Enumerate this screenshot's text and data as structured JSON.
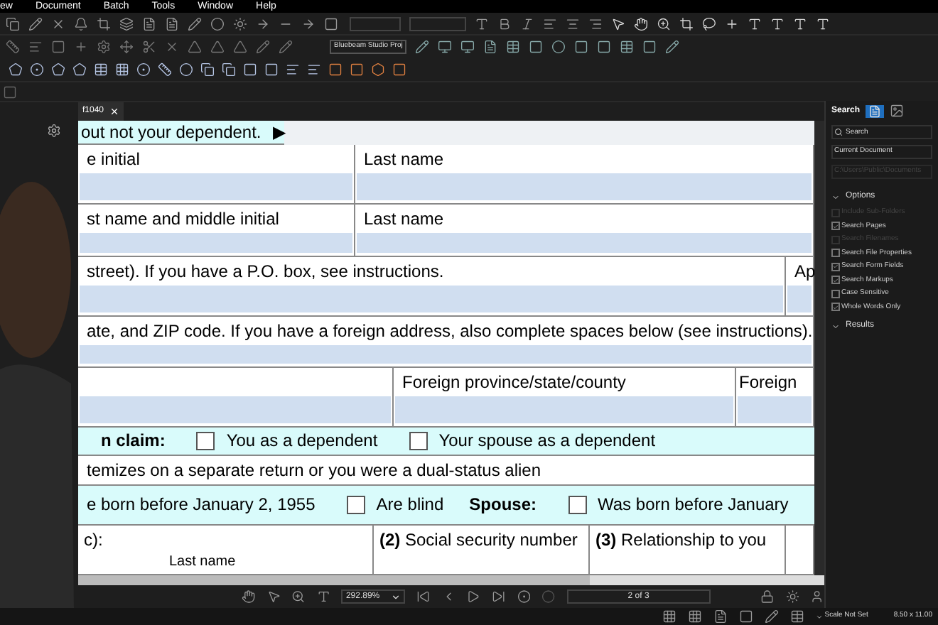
{
  "menu": [
    "ew",
    "Document",
    "Batch",
    "Tools",
    "Window",
    "Help"
  ],
  "toolbar": {
    "studio_project": "Bluebeam Studio Proj"
  },
  "tabs": [
    {
      "label": "f1040",
      "selected": true
    }
  ],
  "form": [
    {
      "kind": "banner",
      "text": "out not your dependent.",
      "arrow": "▶"
    },
    {
      "kind": "fields",
      "cells": [
        {
          "label": "e initial"
        },
        {
          "label": "Last name"
        }
      ]
    },
    {
      "kind": "fields",
      "cells": [
        {
          "label": "st name and middle initial"
        },
        {
          "label": "Last name"
        }
      ]
    },
    {
      "kind": "fields",
      "cells": [
        {
          "label": "street). If you have a P.O. box, see instructions."
        },
        {
          "label": "Ap"
        }
      ]
    },
    {
      "kind": "fields",
      "cells": [
        {
          "label": "ate, and ZIP code. If you have a foreign address, also complete spaces below (see instructions)."
        }
      ]
    },
    {
      "kind": "fields",
      "cells": [
        {},
        {
          "label": "Foreign province/state/county"
        },
        {
          "label": "Foreign"
        }
      ]
    },
    {
      "kind": "checks",
      "items": [
        {
          "kind": "bold",
          "text": "n claim:"
        },
        {
          "kind": "check",
          "text": "You as a dependent",
          "checked": false
        },
        {
          "kind": "check",
          "text": "Your spouse as a dependent",
          "checked": false
        }
      ]
    },
    {
      "kind": "line",
      "text": "temizes on a separate return or you were a dual-status alien"
    },
    {
      "kind": "checks",
      "items": [
        {
          "kind": "text",
          "text": "e born before January 2, 1955"
        },
        {
          "kind": "check",
          "text": "Are blind",
          "checked": false
        },
        {
          "kind": "bold",
          "text": "Spouse:"
        },
        {
          "kind": "check",
          "text": "Was born before January",
          "checked": false
        }
      ]
    },
    {
      "kind": "heads",
      "cells": [
        {
          "label": "c):",
          "sub": "Last name"
        },
        {
          "label": "**(2)** Social security number"
        },
        {
          "label": "**(3)** Relationship to you"
        },
        {}
      ]
    }
  ],
  "search_panel": {
    "title": "Search",
    "search": {
      "placeholder": "Search"
    },
    "scope": "Current Document",
    "path": "C:\\Users\\Public\\Documents",
    "options": {
      "label": "Options",
      "expanded": true,
      "items": [
        {
          "label": "Include Sub-Folders",
          "checked": false,
          "disabled": true
        },
        {
          "label": "Search Pages",
          "checked": true,
          "disabled": false
        },
        {
          "label": "Search Filenames",
          "checked": false,
          "disabled": true
        },
        {
          "label": "Search File Properties",
          "checked": false,
          "disabled": false
        },
        {
          "label": "Search Form Fields",
          "checked": true,
          "disabled": false
        },
        {
          "label": "Search Markups",
          "checked": true,
          "disabled": false
        },
        {
          "label": "Case Sensitive",
          "checked": false,
          "disabled": false
        },
        {
          "label": "Whole Words Only",
          "checked": true,
          "disabled": false
        }
      ]
    },
    "results": {
      "label": "Results",
      "expanded": true
    }
  },
  "bottom_bar": {
    "zoom": "292.89%",
    "page": "2 of 3"
  },
  "status_bar": {
    "scale": "Scale Not Set",
    "size": "8.50 x 11.00"
  }
}
